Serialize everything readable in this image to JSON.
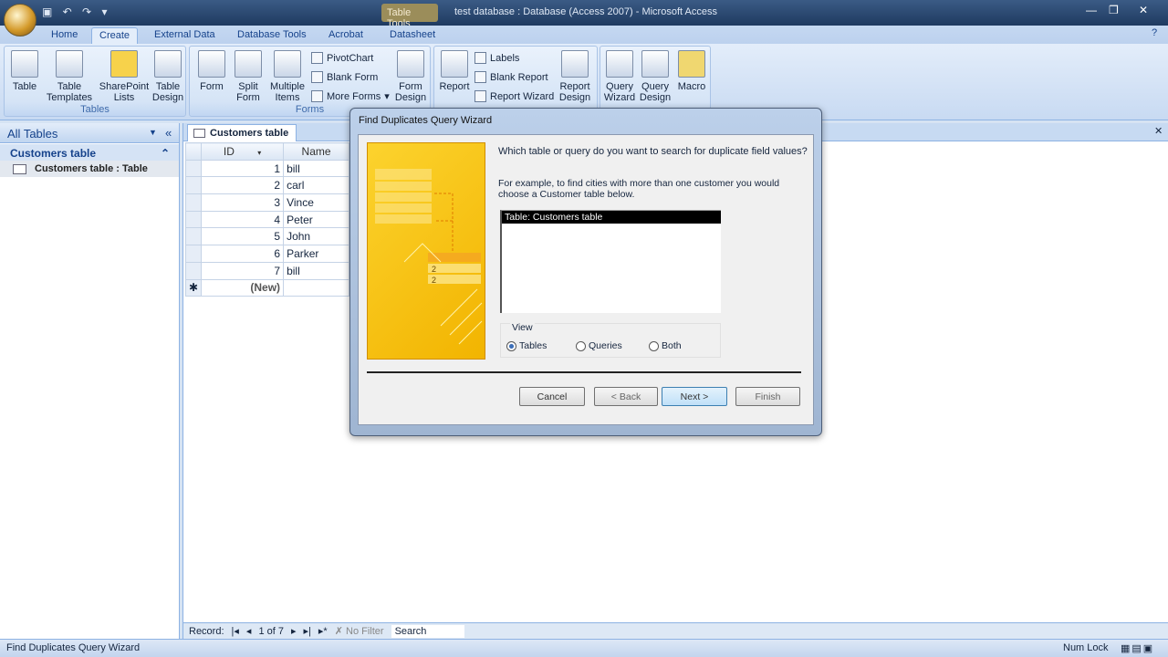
{
  "window": {
    "contextual_tab": "Table Tools",
    "title": "test database : Database (Access 2007) - Microsoft Access"
  },
  "tabs": [
    "Home",
    "Create",
    "External Data",
    "Database Tools",
    "Acrobat",
    "Datasheet"
  ],
  "active_tab": "Create",
  "ribbon": {
    "tables": {
      "label": "Tables",
      "buttons": [
        "Table",
        "Table Templates",
        "SharePoint Lists",
        "Table Design"
      ]
    },
    "forms": {
      "label": "Forms",
      "buttons": [
        "Form",
        "Split Form",
        "Multiple Items",
        "Form Design"
      ],
      "small": [
        "PivotChart",
        "Blank Form",
        "More Forms"
      ]
    },
    "reports": {
      "buttons": [
        "Report",
        "Report Design"
      ],
      "small": [
        "Labels",
        "Blank Report",
        "Report Wizard"
      ]
    },
    "other": {
      "buttons": [
        "Query Wizard",
        "Query Design",
        "Macro"
      ]
    }
  },
  "nav": {
    "header": "All Tables",
    "group": "Customers table",
    "item": "Customers table : Table"
  },
  "document": {
    "tab": "Customers table",
    "columns": [
      "ID",
      "Name"
    ],
    "rows": [
      [
        "1",
        "bill"
      ],
      [
        "2",
        "carl"
      ],
      [
        "3",
        "Vince"
      ],
      [
        "4",
        "Peter"
      ],
      [
        "5",
        "John"
      ],
      [
        "6",
        "Parker"
      ],
      [
        "7",
        "bill"
      ]
    ],
    "new_row": "(New)"
  },
  "record_nav": {
    "label": "Record:",
    "position": "1 of 7",
    "filter": "No Filter",
    "search": "Search"
  },
  "dialog": {
    "title": "Find Duplicates Query Wizard",
    "question": "Which table or query do you want to search for duplicate field values?",
    "example": "For example, to find cities with more than one customer you would choose a Customer table below.",
    "list": [
      "Table: Customers table"
    ],
    "view_label": "View",
    "view_options": [
      "Tables",
      "Queries",
      "Both"
    ],
    "view_selected": "Tables",
    "buttons": {
      "cancel": "Cancel",
      "back": "< Back",
      "next": "Next >",
      "finish": "Finish"
    }
  },
  "status": {
    "left": "Find Duplicates Query Wizard",
    "right": "Num Lock"
  },
  "colors": {
    "accent": "#15428b",
    "ribbon": "#d5e4f6",
    "wizard_art": "#fcd32e"
  }
}
